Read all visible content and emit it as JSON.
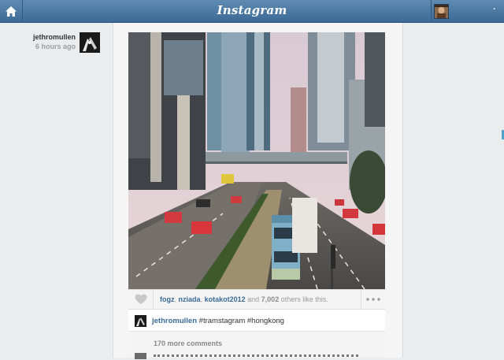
{
  "app": {
    "logo": "Instagram"
  },
  "topbar": {
    "home_icon": "home-icon",
    "profile_icon": "user-avatar",
    "logout_label": "·"
  },
  "post": {
    "owner": "jethromullen",
    "time_ago": "6 hours ago",
    "likers": [
      "fogz",
      "nziada",
      "kotakot2012"
    ],
    "separator_1": ",",
    "separator_2": ",",
    "others_prefix": "and",
    "others_count": "7,002",
    "others_suffix": "others like this.",
    "caption_user": "jethromullen",
    "caption_text": "#tramstagram #hongkong",
    "more_comments": "170 more comments"
  },
  "colors": {
    "topbar": "#4a7aa6",
    "link": "#3b6b97",
    "background": "#eaecee"
  }
}
